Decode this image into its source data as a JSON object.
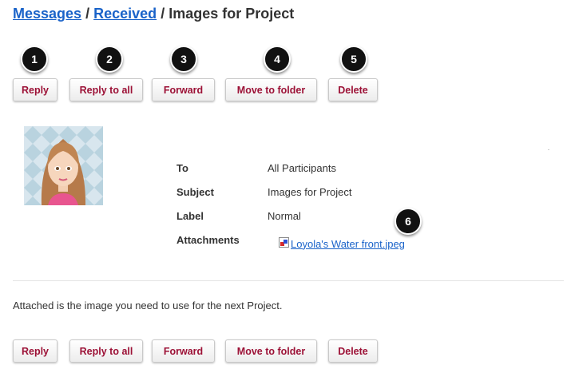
{
  "breadcrumb": {
    "messages": "Messages",
    "received": "Received",
    "separator": "/",
    "current": "Images for Project"
  },
  "toolbar": {
    "reply": "Reply",
    "reply_all": "Reply to all",
    "forward": "Forward",
    "move": "Move to folder",
    "delete": "Delete"
  },
  "badges": [
    "1",
    "2",
    "3",
    "4",
    "5",
    "6"
  ],
  "message": {
    "to_label": "To",
    "to_value": "All Participants",
    "subject_label": "Subject",
    "subject_value": "Images for Project",
    "label_label": "Label",
    "label_value": "Normal",
    "attachments_label": "Attachments",
    "attachment_name": "Loyola's Water front.jpeg",
    "body": "Attached is the image you need to use for the next Project."
  },
  "colors": {
    "link": "#1a63c9",
    "button_text": "#9c1136"
  }
}
